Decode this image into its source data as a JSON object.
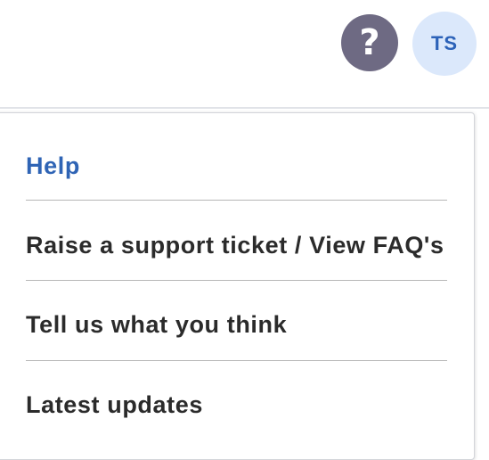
{
  "header": {
    "help_button": {
      "label": "?",
      "color": "#6e6a83"
    },
    "avatar": {
      "initials": "TS",
      "background": "#dbe8fb",
      "text_color": "#2c62b8"
    }
  },
  "help_menu": {
    "title": "Help",
    "title_color": "#2f64b5",
    "items": [
      {
        "label": "Raise a support ticket / View FAQ's"
      },
      {
        "label": "Tell us what you think"
      },
      {
        "label": "Latest updates"
      }
    ]
  }
}
